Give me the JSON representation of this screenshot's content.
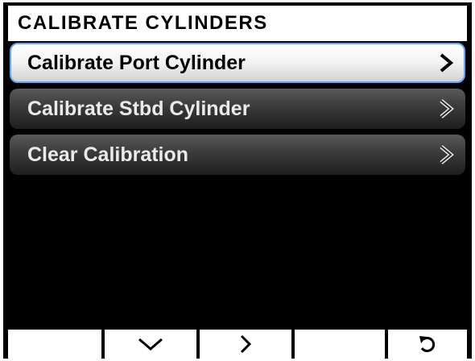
{
  "title": "CALIBRATE CYLINDERS",
  "menu": {
    "items": [
      {
        "label": "Calibrate Port Cylinder",
        "selected": true
      },
      {
        "label": "Calibrate Stbd Cylinder",
        "selected": false
      },
      {
        "label": "Clear Calibration",
        "selected": false
      }
    ]
  },
  "softkeys": [
    {
      "icon": "none"
    },
    {
      "icon": "chevron-down-icon"
    },
    {
      "icon": "chevron-right-icon"
    },
    {
      "icon": "none"
    },
    {
      "icon": "back-arrow-icon"
    }
  ],
  "colors": {
    "selection_border": "#5fa8ff",
    "background": "#000000",
    "title_bar": "#ffffff"
  }
}
